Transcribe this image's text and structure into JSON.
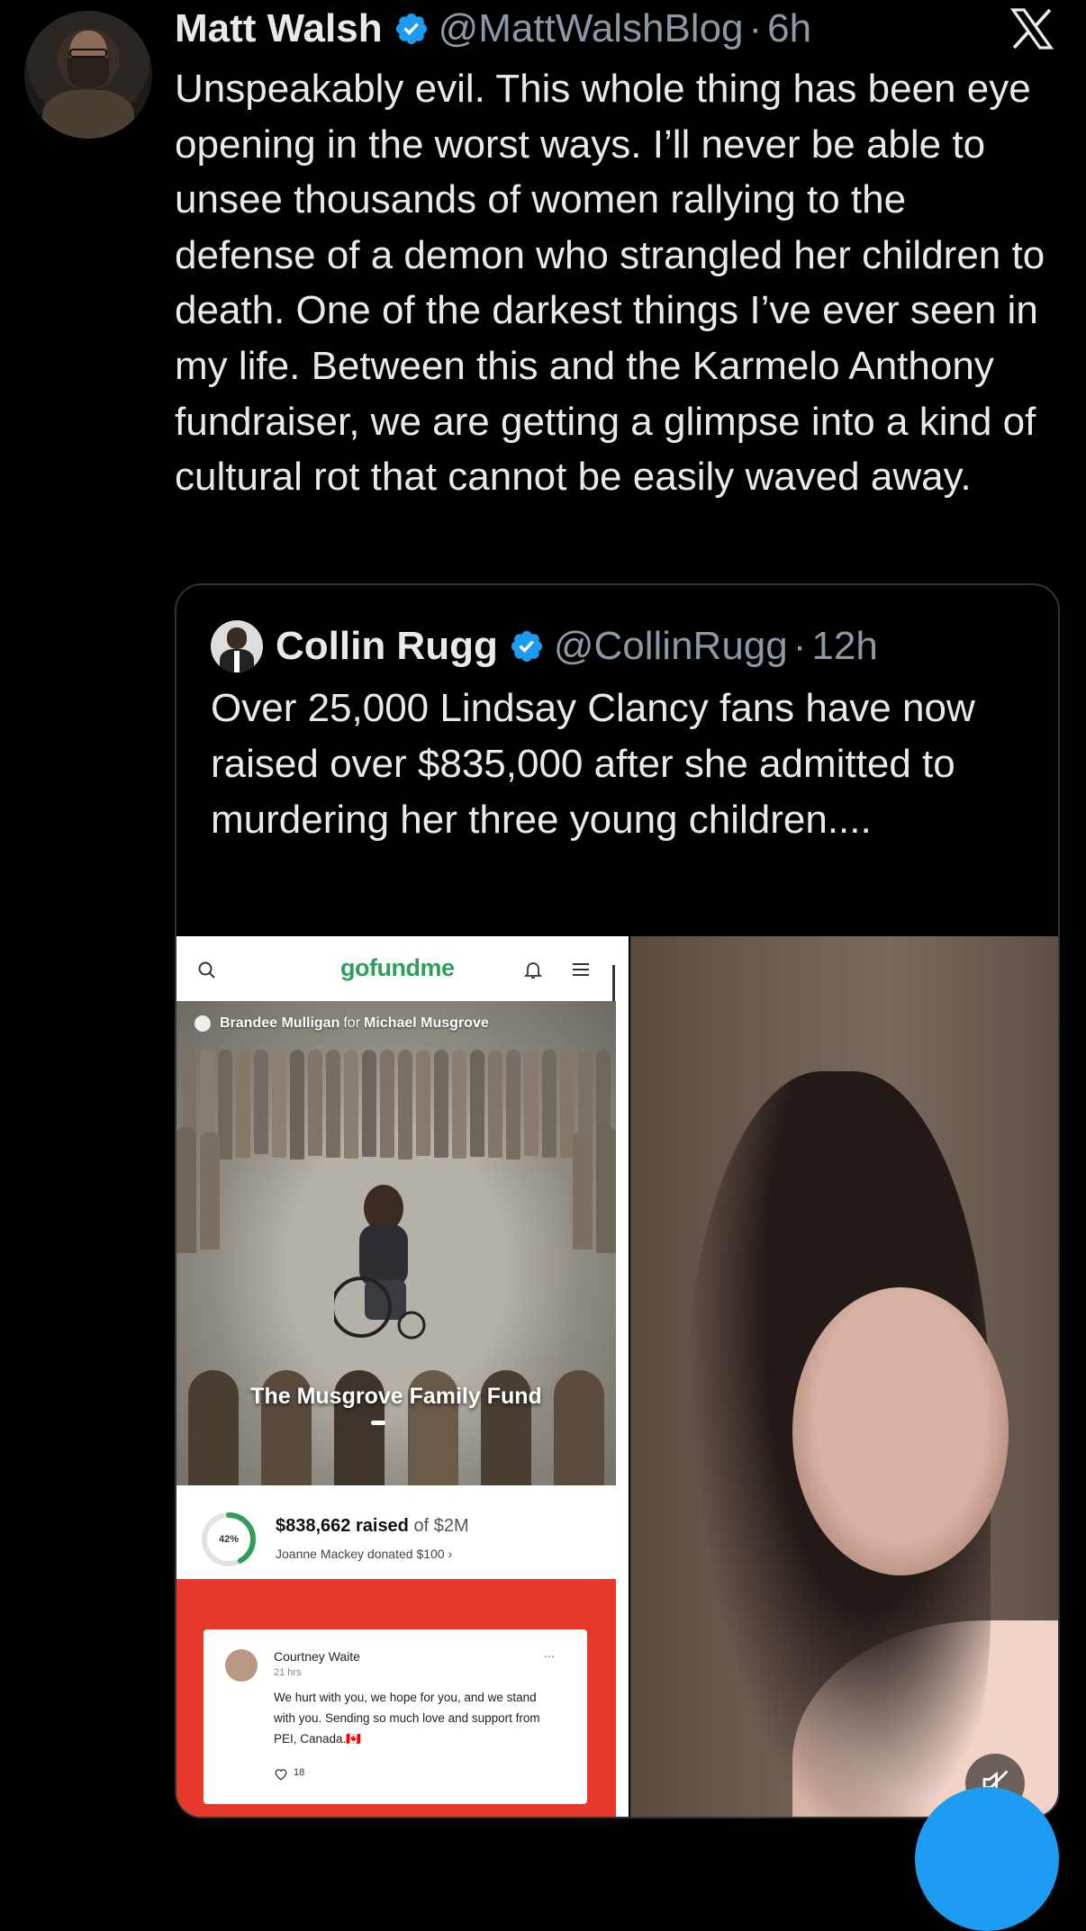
{
  "tweet": {
    "author_name": "Matt Walsh",
    "author_handle": "@MattWalshBlog",
    "separator": "·",
    "time": "6h",
    "text": "Unspeakably evil. This whole thing has been eye opening in the worst ways. I’ll never be able to unsee thousands of women rallying to the defense of a demon who strangled her children to death. One of the darkest things I’ve ever seen in my life. Between this and the Karmelo Anthony fundraiser, we are getting a glimpse into a kind of cultural rot that cannot be easily waved away."
  },
  "quote": {
    "author_name": "Collin Rugg",
    "author_handle": "@CollinRugg",
    "separator": "·",
    "time": "12h",
    "text": "Over 25,000 Lindsay Clancy fans have now raised over $835,000 after she admitted to murdering her three young children...."
  },
  "gofundme": {
    "logo": "gofundme",
    "organizer": "Brandee Mulligan",
    "for_word": "for",
    "beneficiary": "Michael Musgrove",
    "fund_title": "The Musgrove Family Fund",
    "progress_percent": 42,
    "progress_label": "42%",
    "raised_amount": "$838,662 raised",
    "goal": "of $2M",
    "latest_donation": "Joanne Mackey donated $100 ›",
    "comment": {
      "author": "Courtney Waite",
      "time": "21 hrs",
      "more": "...",
      "body": "We hurt with you, we hope for you, and we stand with you. Sending so much love and support from PEI, Canada.🇨🇦",
      "likes": "18"
    }
  },
  "icons": {
    "verified": "verified-badge-icon",
    "x_logo": "x-logo-icon",
    "mute": "mute-icon",
    "search": "search-icon",
    "bell": "bell-icon",
    "menu": "menu-icon",
    "heart": "heart-icon"
  },
  "colors": {
    "background": "#000000",
    "text": "#e7e9ea",
    "secondary_text": "#8b98a5",
    "verified_blue": "#1d9bf0",
    "gofundme_green": "#2e9e5b",
    "gofundme_red": "#e6382b"
  }
}
